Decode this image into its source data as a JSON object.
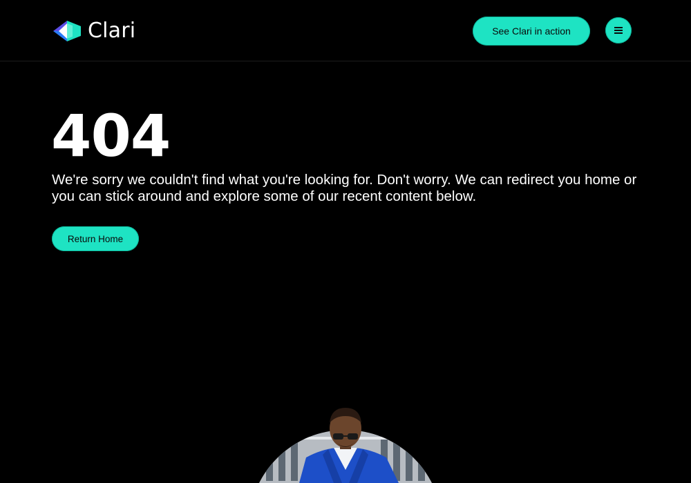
{
  "header": {
    "brand_name": "Clari",
    "cta_label": "See Clari in action",
    "menu_icon": "hamburger-menu-icon"
  },
  "main": {
    "error_code": "404",
    "message": "We're sorry we couldn't find what you're looking for. Don't worry. We can redirect you home or you can stick around and explore some of our recent content below.",
    "return_label": "Return Home"
  },
  "colors": {
    "background": "#000000",
    "accent": "#1ee3c3",
    "text": "#ffffff",
    "button_text": "#0a0a0a"
  }
}
